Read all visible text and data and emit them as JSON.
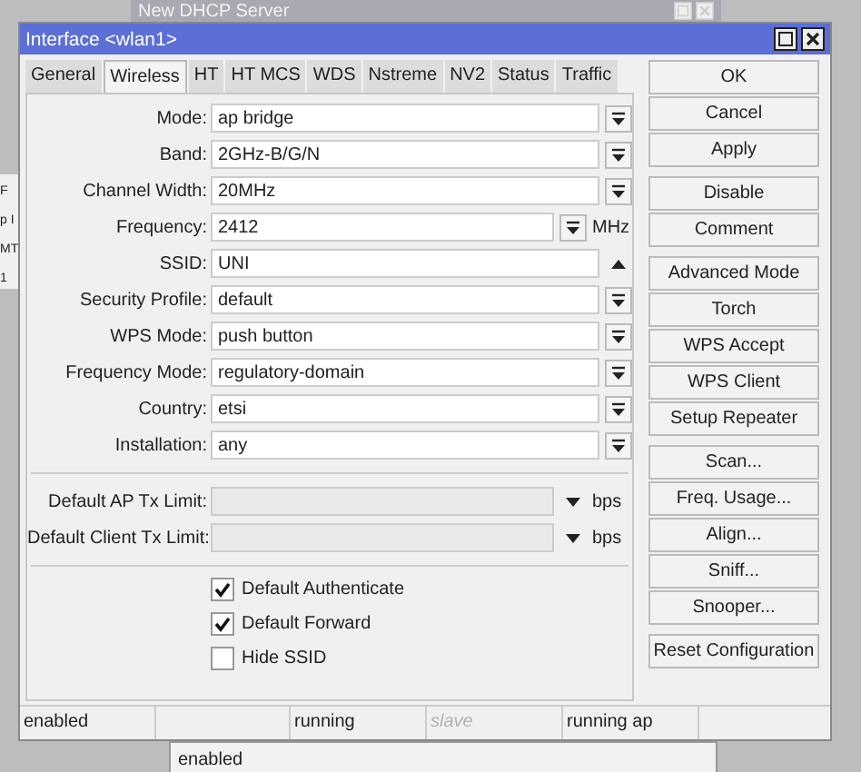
{
  "background_window": {
    "title": "New DHCP Server",
    "fragments": [
      "F",
      "p I",
      "MT",
      "1"
    ],
    "status": "enabled"
  },
  "window": {
    "title": "Interface <wlan1>"
  },
  "tabs": [
    {
      "label": "General",
      "selected": false
    },
    {
      "label": "Wireless",
      "selected": true
    },
    {
      "label": "HT",
      "selected": false
    },
    {
      "label": "HT MCS",
      "selected": false
    },
    {
      "label": "WDS",
      "selected": false
    },
    {
      "label": "Nstreme",
      "selected": false
    },
    {
      "label": "NV2",
      "selected": false
    },
    {
      "label": "Status",
      "selected": false
    },
    {
      "label": "Traffic",
      "selected": false
    }
  ],
  "fields": [
    {
      "kind": "combo",
      "label": "Mode:",
      "value": "ap bridge"
    },
    {
      "kind": "combo",
      "label": "Band:",
      "value": "2GHz-B/G/N"
    },
    {
      "kind": "combo",
      "label": "Channel Width:",
      "value": "20MHz"
    },
    {
      "kind": "combo",
      "label": "Frequency:",
      "value": "2412",
      "unit": "MHz"
    },
    {
      "kind": "text",
      "label": "SSID:",
      "value": "UNI"
    },
    {
      "kind": "combo",
      "label": "Security Profile:",
      "value": "default"
    },
    {
      "kind": "combo",
      "label": "WPS Mode:",
      "value": "push button"
    },
    {
      "kind": "combo",
      "label": "Frequency Mode:",
      "value": "regulatory-domain"
    },
    {
      "kind": "combo",
      "label": "Country:",
      "value": "etsi"
    },
    {
      "kind": "combo",
      "label": "Installation:",
      "value": "any"
    },
    {
      "kind": "separator"
    },
    {
      "kind": "limit",
      "label": "Default AP Tx Limit:",
      "unit": "bps"
    },
    {
      "kind": "limit",
      "label": "Default Client Tx Limit:",
      "unit": "bps"
    },
    {
      "kind": "separator"
    }
  ],
  "checkboxes": [
    {
      "label": "Default Authenticate",
      "checked": true
    },
    {
      "label": "Default Forward",
      "checked": true
    },
    {
      "label": "Hide SSID",
      "checked": false
    }
  ],
  "button_groups": [
    [
      "OK",
      "Cancel",
      "Apply"
    ],
    [
      "Disable",
      "Comment"
    ],
    [
      "Advanced Mode",
      "Torch",
      "WPS Accept",
      "WPS Client",
      "Setup Repeater"
    ],
    [
      "Scan...",
      "Freq. Usage...",
      "Align...",
      "Sniff...",
      "Snooper..."
    ],
    [
      "Reset Configuration"
    ]
  ],
  "status_bar": [
    {
      "text": "enabled",
      "disabled": false
    },
    {
      "text": "running",
      "disabled": false
    },
    {
      "text": "slave",
      "disabled": true
    },
    {
      "text": "running ap",
      "disabled": false
    }
  ]
}
